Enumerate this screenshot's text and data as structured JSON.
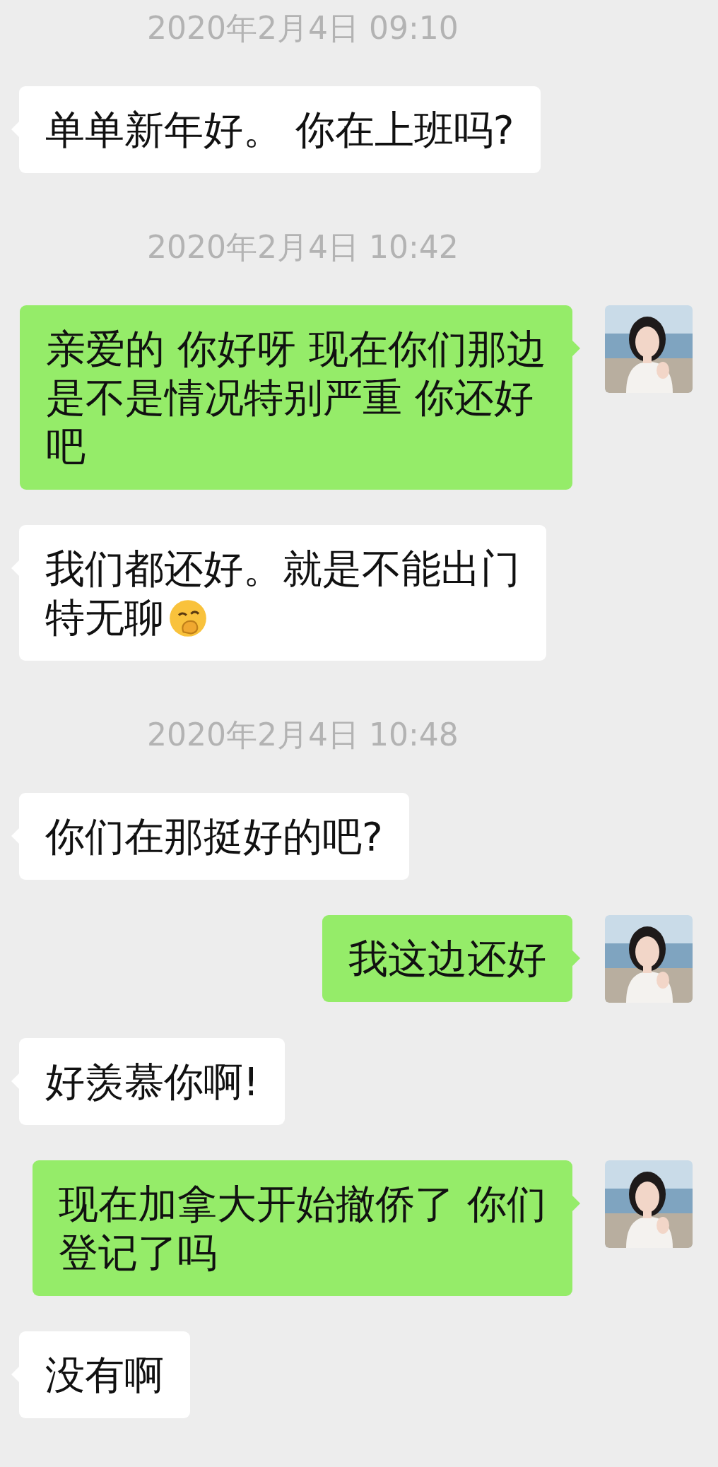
{
  "messages": [
    {
      "kind": "time",
      "text": "2020年2月4日 09:10"
    },
    {
      "kind": "other",
      "lines": [
        "单单新年好。 你在上班吗?"
      ]
    },
    {
      "kind": "time",
      "text": "2020年2月4日 10:42"
    },
    {
      "kind": "self",
      "lines": [
        "亲爱的 你好呀 现在你们那边",
        "是不是情况特别严重 你还好",
        "吧"
      ]
    },
    {
      "kind": "other",
      "lines": [
        "我们都还好。就是不能出门",
        "特无聊"
      ],
      "emoji": true
    },
    {
      "kind": "time",
      "text": "2020年2月4日 10:48"
    },
    {
      "kind": "other",
      "lines": [
        "你们在那挺好的吧?"
      ]
    },
    {
      "kind": "self",
      "lines": [
        "我这边还好"
      ]
    },
    {
      "kind": "other",
      "lines": [
        "好羡慕你啊!"
      ]
    },
    {
      "kind": "self",
      "lines": [
        "现在加拿大开始撤侨了 你们",
        "登记了吗"
      ]
    },
    {
      "kind": "other",
      "lines": [
        "没有啊"
      ]
    }
  ]
}
